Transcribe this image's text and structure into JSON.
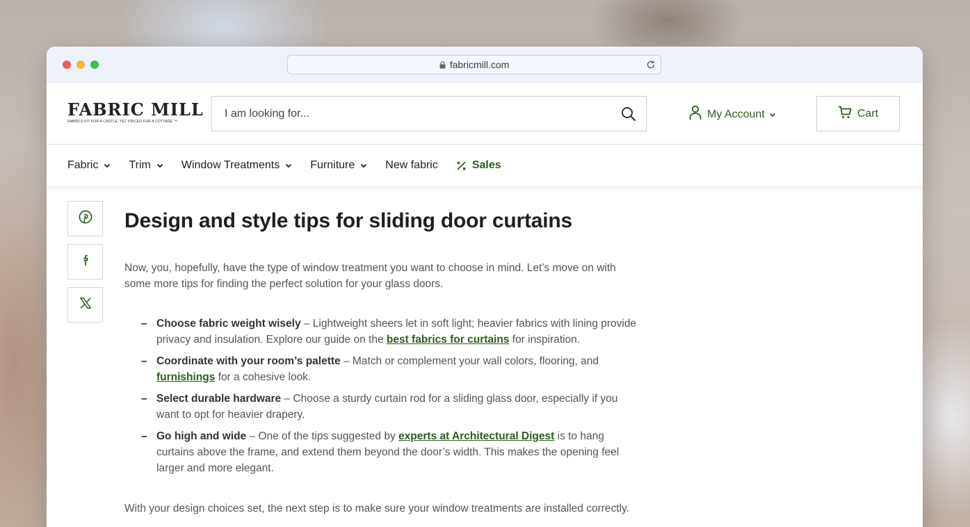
{
  "browser": {
    "url": "fabricmill.com"
  },
  "header": {
    "logo_text": "FABRIC MILL",
    "logo_tagline": "FABRICS FIT FOR A CASTLE, YET PRICED FOR A COTTAGE ™",
    "search_placeholder": "I am looking for...",
    "account_label": "My Account",
    "cart_label": "Cart"
  },
  "nav": {
    "items": [
      {
        "label": "Fabric",
        "has_dropdown": true
      },
      {
        "label": "Trim",
        "has_dropdown": true
      },
      {
        "label": "Window Treatments",
        "has_dropdown": true
      },
      {
        "label": "Furniture",
        "has_dropdown": true
      },
      {
        "label": "New fabric",
        "has_dropdown": false
      },
      {
        "label": "Sales",
        "has_dropdown": false,
        "icon": "percent-icon"
      }
    ]
  },
  "share": {
    "buttons": [
      {
        "icon": "pinterest-icon"
      },
      {
        "icon": "facebook-icon"
      },
      {
        "icon": "x-icon"
      }
    ]
  },
  "article": {
    "title": "Design and style tips for sliding door curtains",
    "intro": "Now, you, hopefully, have the type of window treatment you want to choose in mind. Let’s move on with some more tips for finding the perfect solution for your glass doors.",
    "tips": [
      {
        "bold": "Choose fabric weight wisely",
        "text_before": " – Lightweight sheers let in soft light; heavier fabrics with lining provide privacy and insulation. Explore our guide on the ",
        "link": "best fabrics for curtains",
        "text_after": " for inspiration."
      },
      {
        "bold": "Coordinate with your room’s palette",
        "text_before": " – Match or complement your wall colors, flooring, and ",
        "link": "furnishings",
        "text_after": " for a cohesive look."
      },
      {
        "bold": "Select durable hardware",
        "text_before": " – Choose a sturdy curtain rod for a sliding glass door, especially if you want to opt for heavier drapery.",
        "link": "",
        "text_after": ""
      },
      {
        "bold": "Go high and wide",
        "text_before": " – One of the tips suggested by ",
        "link": "experts at Architectural Digest",
        "text_after": " is to hang curtains above the frame, and extend them beyond the door’s width. This makes the opening feel larger and more elegant."
      }
    ],
    "outro": "With your design choices set, the next step is to make sure your window treatments are installed correctly."
  },
  "colors": {
    "brand_green": "#2e5d1e",
    "text": "#1f1f1f",
    "body_text": "#555555",
    "chrome_bg": "#eef3fb"
  }
}
